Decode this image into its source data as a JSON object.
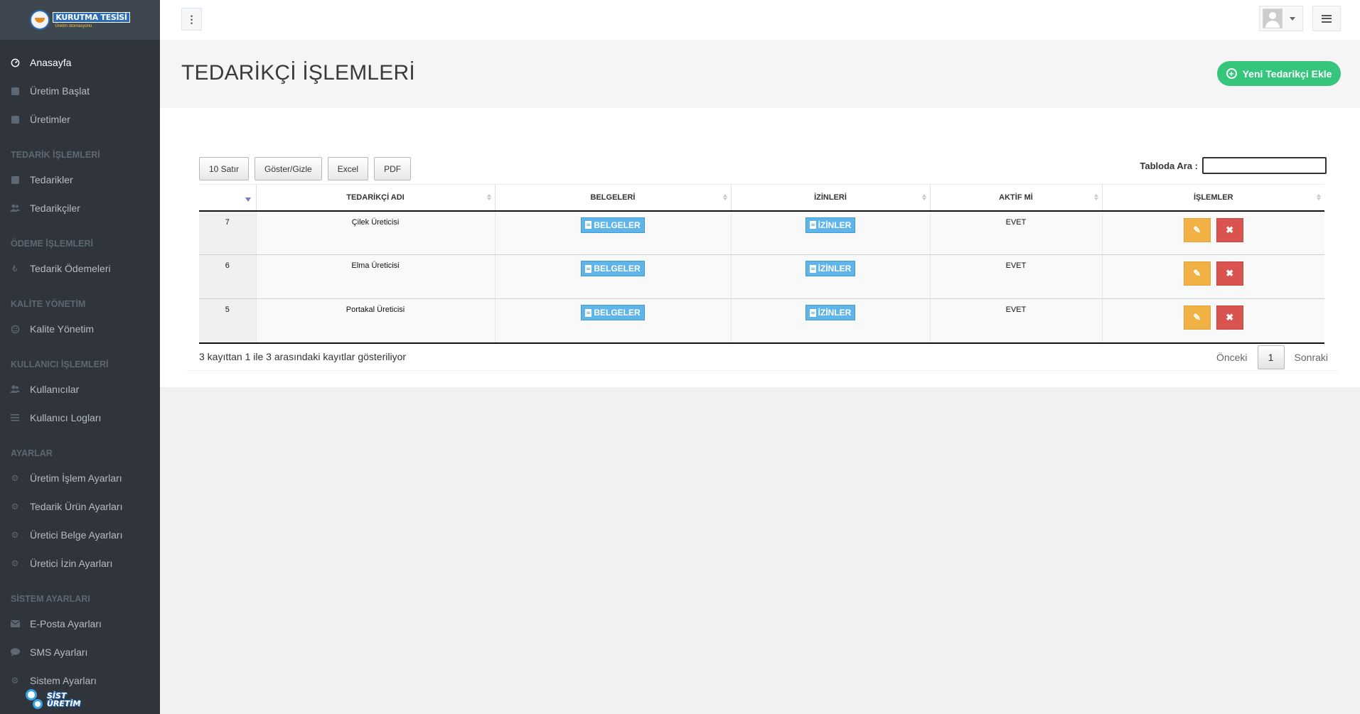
{
  "logo": {
    "line1": "KURUTMA TESİSİ",
    "line2": "Üretim otomasyonu"
  },
  "sidebar": {
    "items_top": [
      {
        "label": "Anasayfa",
        "icon": "dashboard-icon",
        "active": true
      },
      {
        "label": "Üretim Başlat",
        "icon": "square-icon"
      },
      {
        "label": "Üretimler",
        "icon": "square-icon"
      }
    ],
    "sections": [
      {
        "heading": "TEDARİK İŞLEMLERİ",
        "items": [
          {
            "label": "Tedarikler",
            "icon": "square-icon"
          },
          {
            "label": "Tedarikçiler",
            "icon": "users-icon"
          }
        ]
      },
      {
        "heading": "ÖDEME İŞLEMLERİ",
        "items": [
          {
            "label": "Tedarik Ödemeleri",
            "icon": "lira-icon"
          }
        ]
      },
      {
        "heading": "KALİTE YÖNETİM",
        "items": [
          {
            "label": "Kalite Yönetim",
            "icon": "smile-icon"
          }
        ]
      },
      {
        "heading": "KULLANICI İŞLEMLERİ",
        "items": [
          {
            "label": "Kullanıcılar",
            "icon": "users-icon"
          },
          {
            "label": "Kullanıcı Logları",
            "icon": "list-icon"
          }
        ]
      },
      {
        "heading": "AYARLAR",
        "items": [
          {
            "label": "Üretim İşlem Ayarları",
            "icon": "gears-icon"
          },
          {
            "label": "Tedarik Ürün Ayarları",
            "icon": "gears-icon"
          },
          {
            "label": "Üretici Belge Ayarları",
            "icon": "gears-icon"
          },
          {
            "label": "Üretici İzin Ayarları",
            "icon": "gears-icon"
          }
        ]
      },
      {
        "heading": "SİSTEM AYARLARI",
        "items": [
          {
            "label": "E-Posta Ayarları",
            "icon": "envelope-icon"
          },
          {
            "label": "SMS Ayarları",
            "icon": "comment-icon"
          },
          {
            "label": "Sistem Ayarları",
            "icon": "gears-icon"
          }
        ]
      }
    ],
    "footer_logo": {
      "line1": "SİST",
      "line2": "ÜRETİM"
    }
  },
  "page": {
    "title": "TEDARİKÇİ İŞLEMLERİ",
    "add_button": "Yeni Tedarikçi Ekle"
  },
  "table_tools": {
    "buttons": [
      "10 Satır",
      "Göster/Gizle",
      "Excel",
      "PDF"
    ],
    "search_label": "Tabloda Ara :",
    "search_value": ""
  },
  "table": {
    "columns": [
      "",
      "TEDARİKÇİ ADI",
      "BELGELERİ",
      "İZİNLERİ",
      "AKTİF Mİ",
      "İŞLEMLER"
    ],
    "rows": [
      {
        "id": "7",
        "name": "Çilek Üreticisi",
        "docs": "BELGELER",
        "perms": "İZİNLER",
        "active": "EVET"
      },
      {
        "id": "6",
        "name": "Elma Üreticisi",
        "docs": "BELGELER",
        "perms": "İZİNLER",
        "active": "EVET"
      },
      {
        "id": "5",
        "name": "Portakal Üreticisi",
        "docs": "BELGELER",
        "perms": "İZİNLER",
        "active": "EVET"
      }
    ]
  },
  "footer": {
    "info": "3 kayıttan 1 ile 3 arasındaki kayıtlar gösteriliyor",
    "prev": "Önceki",
    "current": "1",
    "next": "Sonraki"
  },
  "colors": {
    "sidebar_bg": "#2f353b",
    "add_button": "#36c57d",
    "doc_button": "#5fb4ea",
    "edit_button": "#f1b144",
    "delete_button": "#d9534f"
  }
}
